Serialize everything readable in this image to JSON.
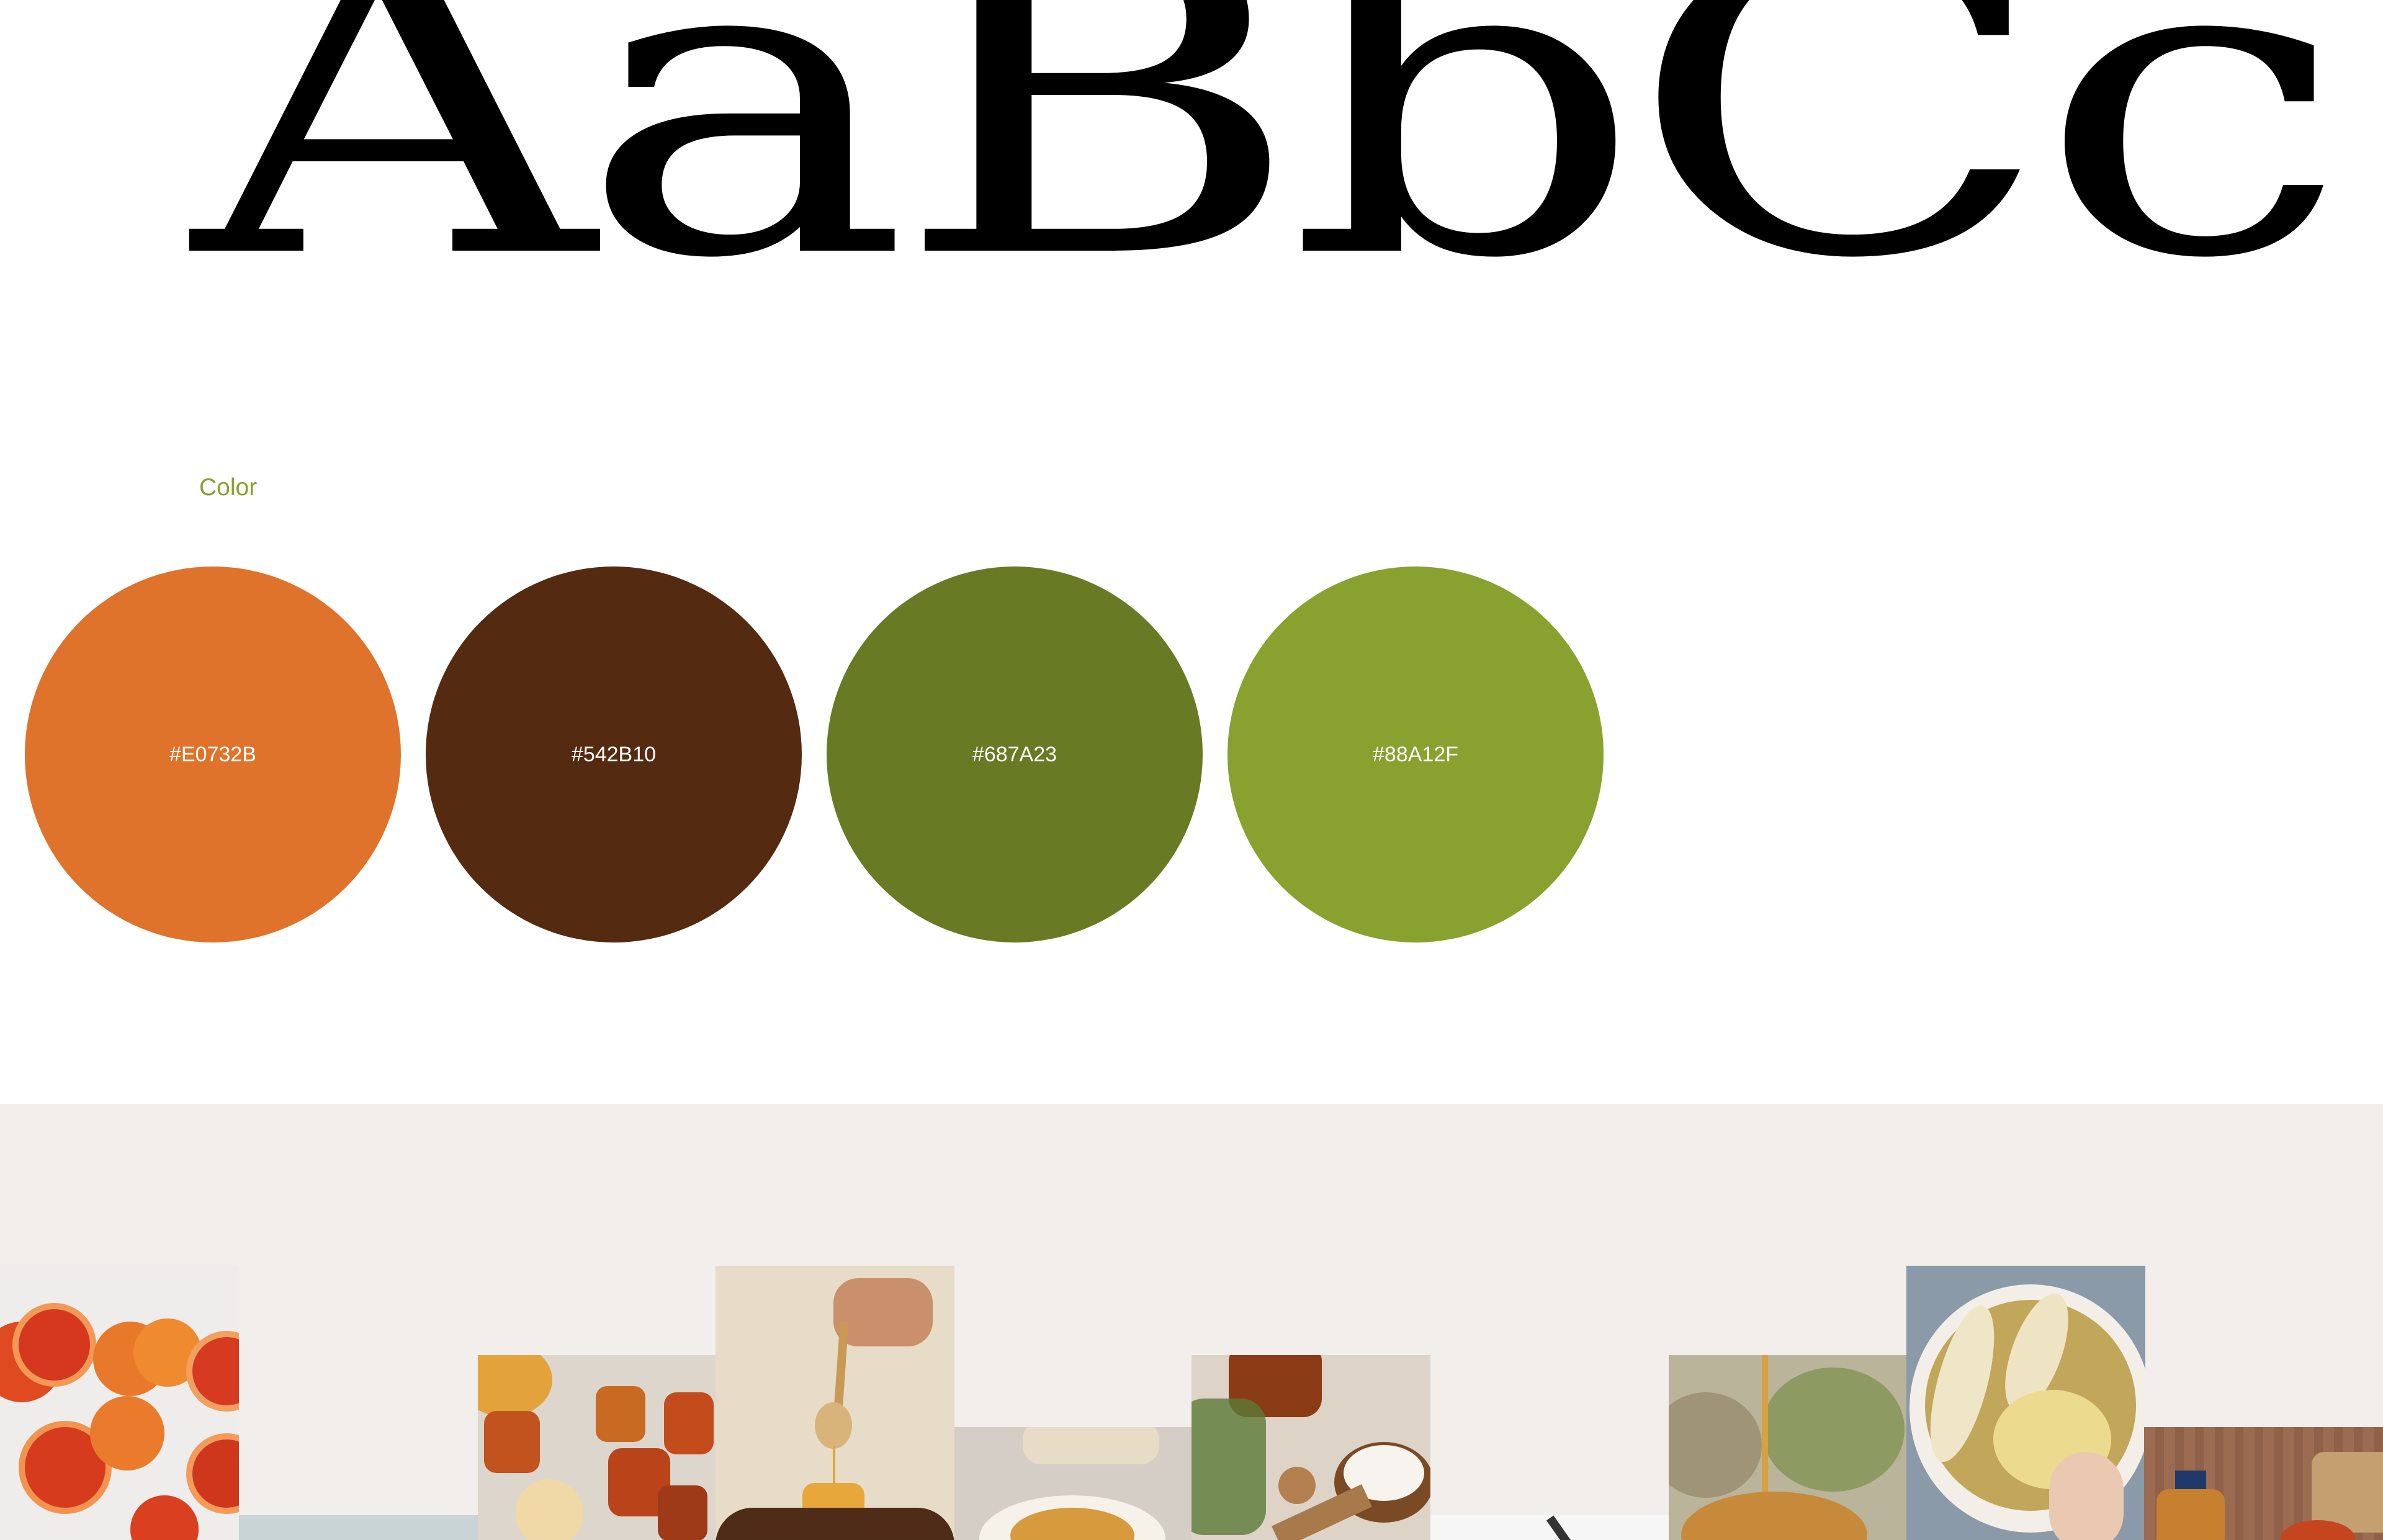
{
  "type_specimen": {
    "text": "AaBbCc"
  },
  "color_section": {
    "label": "Color",
    "swatches": [
      {
        "hex": "#E0732B",
        "label": "#E0732B"
      },
      {
        "hex": "#542B10",
        "label": "#542B10"
      },
      {
        "hex": "#687A23",
        "label": "#687A23"
      },
      {
        "hex": "#88A12F",
        "label": "#88A12F"
      }
    ]
  },
  "gallery": {
    "background": "#f1eeec",
    "photos": [
      "blood-orange-slices-photo",
      "honey-jars-photo",
      "honey-spoon-photo",
      "toast-bowl-photo",
      "syrup-coconut-photo",
      "honey-dipper-photo",
      "banana-mash-photo",
      "syrup-bottle-photo"
    ]
  }
}
